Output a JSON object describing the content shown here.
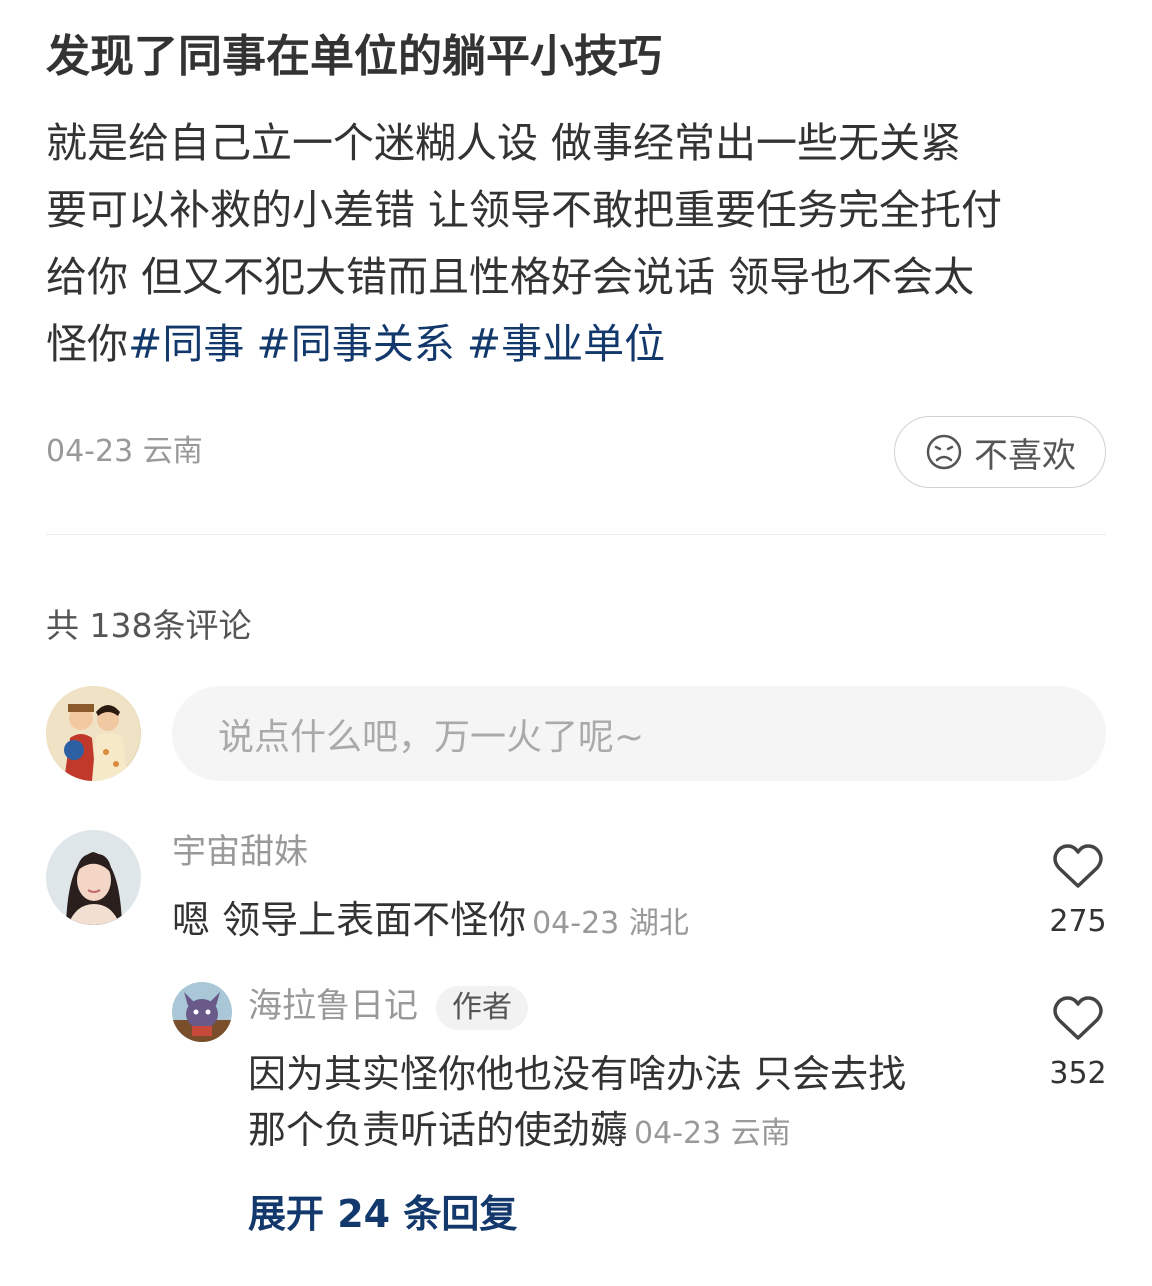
{
  "post": {
    "title": "发现了同事在单位的躺平小技巧",
    "body_lines": [
      "就是给自己立一个迷糊人设 做事经常出一些无关紧",
      "要可以补救的小差错 让领导不敢把重要任务完全托付",
      "给你 但又不犯大错而且性格好会说话 领导也不会太"
    ],
    "body_last_prefix": "怪你",
    "tags": [
      "#同事",
      "#同事关系",
      "#事业单位"
    ],
    "date": "04-23",
    "location": "云南",
    "dislike_label": "不喜欢",
    "dislike_icon": "frown-icon"
  },
  "comments_header": {
    "label": "共 138条评论"
  },
  "composer": {
    "placeholder": "说点什么吧，万一火了呢~"
  },
  "comments": [
    {
      "username": "宇宙甜妹",
      "text": "嗯 领导上表面不怪你",
      "date": "04-23",
      "location": "湖北",
      "likes": "275"
    }
  ],
  "reply": {
    "username": "海拉鲁日记",
    "badge": "作者",
    "text_line1": "因为其实怪你他也没有啥办法 只会去找",
    "text_line2": "那个负责听话的使劲薅",
    "date": "04-23",
    "location": "云南",
    "likes": "352"
  },
  "expand_replies": "展开 24 条回复",
  "colors": {
    "tag": "#13386c",
    "text": "#333333",
    "muted": "#999999"
  }
}
